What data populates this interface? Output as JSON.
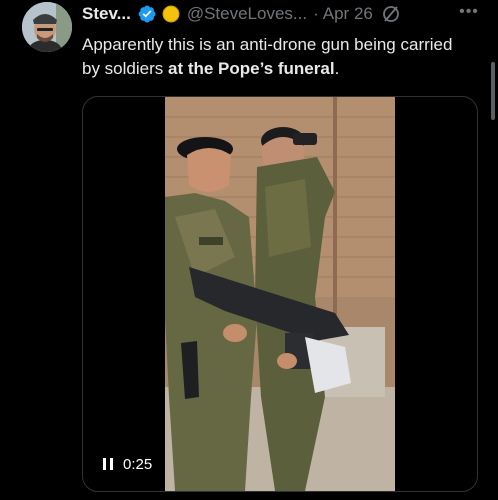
{
  "author": {
    "display_name": "Stev...",
    "handle": "@SteveLoves...",
    "date": "Apr 26"
  },
  "icons": {
    "verified": "verified-badge-icon",
    "emoji_badge": "yellow-circle-badge-icon",
    "grok": "grok-icon",
    "more": "more-options-icon",
    "pause": "pause-icon"
  },
  "tweet": {
    "text_part1": "Apparently this is an anti-drone gun being carried by soldiers ",
    "text_bold": "at the Pope’s funeral",
    "text_end": "."
  },
  "video": {
    "elapsed": "0:25"
  },
  "colors": {
    "background": "#000000",
    "text": "#e7e9ea",
    "muted": "#71767b",
    "verified_blue": "#1d9bf0",
    "border": "#2f3336"
  }
}
